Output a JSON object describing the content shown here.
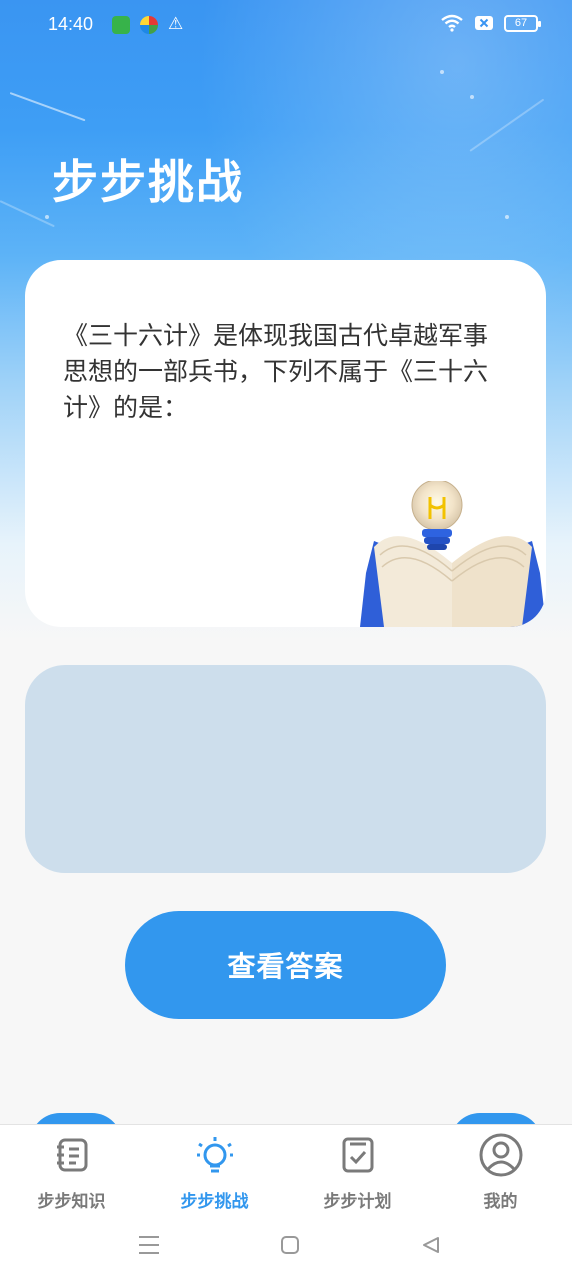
{
  "status_bar": {
    "time": "14:40",
    "battery": "67"
  },
  "page": {
    "title": "步步挑战"
  },
  "question": {
    "text": "《三十六计》是体现我国古代卓越军事思想的一部兵书，下列不属于《三十六计》的是："
  },
  "actions": {
    "view_answer_label": "查看答案"
  },
  "tabs": [
    {
      "label": "步步知识",
      "icon": "notebook-icon",
      "active": false
    },
    {
      "label": "步步挑战",
      "icon": "lightbulb-icon",
      "active": true
    },
    {
      "label": "步步计划",
      "icon": "checklist-icon",
      "active": false
    },
    {
      "label": "我的",
      "icon": "user-icon",
      "active": false
    }
  ],
  "colors": {
    "accent": "#3297ee",
    "answer_box": "#cddeec",
    "inactive_tab": "#7a7a7a"
  }
}
